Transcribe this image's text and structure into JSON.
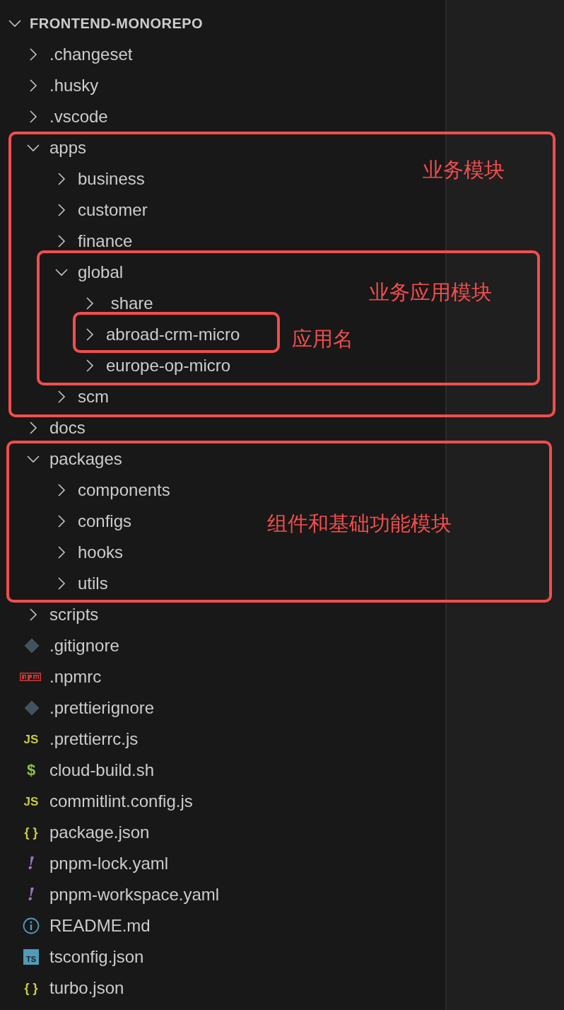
{
  "explorer": {
    "root": {
      "label": "FRONTEND-MONOREPO",
      "expanded": true
    },
    "items": [
      {
        "kind": "folder",
        "label": ".changeset",
        "expanded": false
      },
      {
        "kind": "folder",
        "label": ".husky",
        "expanded": false
      },
      {
        "kind": "folder",
        "label": ".vscode",
        "expanded": false
      },
      {
        "kind": "folder",
        "label": "apps",
        "expanded": true,
        "children": [
          {
            "kind": "folder",
            "label": "business",
            "expanded": false
          },
          {
            "kind": "folder",
            "label": "customer",
            "expanded": false
          },
          {
            "kind": "folder",
            "label": "finance",
            "expanded": false
          },
          {
            "kind": "folder",
            "label": "global",
            "expanded": true,
            "children": [
              {
                "kind": "folder",
                "label": " share",
                "expanded": false
              },
              {
                "kind": "folder",
                "label": "abroad-crm-micro",
                "expanded": false
              },
              {
                "kind": "folder",
                "label": "europe-op-micro",
                "expanded": false
              }
            ]
          },
          {
            "kind": "folder",
            "label": "scm",
            "expanded": false
          }
        ]
      },
      {
        "kind": "folder",
        "label": "docs",
        "expanded": false
      },
      {
        "kind": "folder",
        "label": "packages",
        "expanded": true,
        "children": [
          {
            "kind": "folder",
            "label": "components",
            "expanded": false
          },
          {
            "kind": "folder",
            "label": "configs",
            "expanded": false
          },
          {
            "kind": "folder",
            "label": "hooks",
            "expanded": false
          },
          {
            "kind": "folder",
            "label": "utils",
            "expanded": false
          }
        ]
      },
      {
        "kind": "folder",
        "label": "scripts",
        "expanded": false
      },
      {
        "kind": "git",
        "label": ".gitignore"
      },
      {
        "kind": "npm",
        "label": ".npmrc"
      },
      {
        "kind": "git",
        "label": ".prettierignore"
      },
      {
        "kind": "js",
        "label": ".prettierrc.js",
        "glyph": "JS"
      },
      {
        "kind": "shell",
        "label": "cloud-build.sh",
        "glyph": "$"
      },
      {
        "kind": "js",
        "label": "commitlint.config.js",
        "glyph": "JS"
      },
      {
        "kind": "json",
        "label": "package.json",
        "glyph": "{ }"
      },
      {
        "kind": "yaml",
        "label": "pnpm-lock.yaml",
        "glyph": "!"
      },
      {
        "kind": "yaml",
        "label": "pnpm-workspace.yaml",
        "glyph": "!"
      },
      {
        "kind": "info",
        "label": "README.md"
      },
      {
        "kind": "ts",
        "label": "tsconfig.json",
        "glyph": "TS"
      },
      {
        "kind": "json",
        "label": "turbo.json",
        "glyph": "{ }"
      }
    ]
  },
  "annotations": [
    {
      "label": "业务模块"
    },
    {
      "label": "业务应用模块"
    },
    {
      "label": "应用名"
    },
    {
      "label": "组件和基础功能模块"
    }
  ]
}
